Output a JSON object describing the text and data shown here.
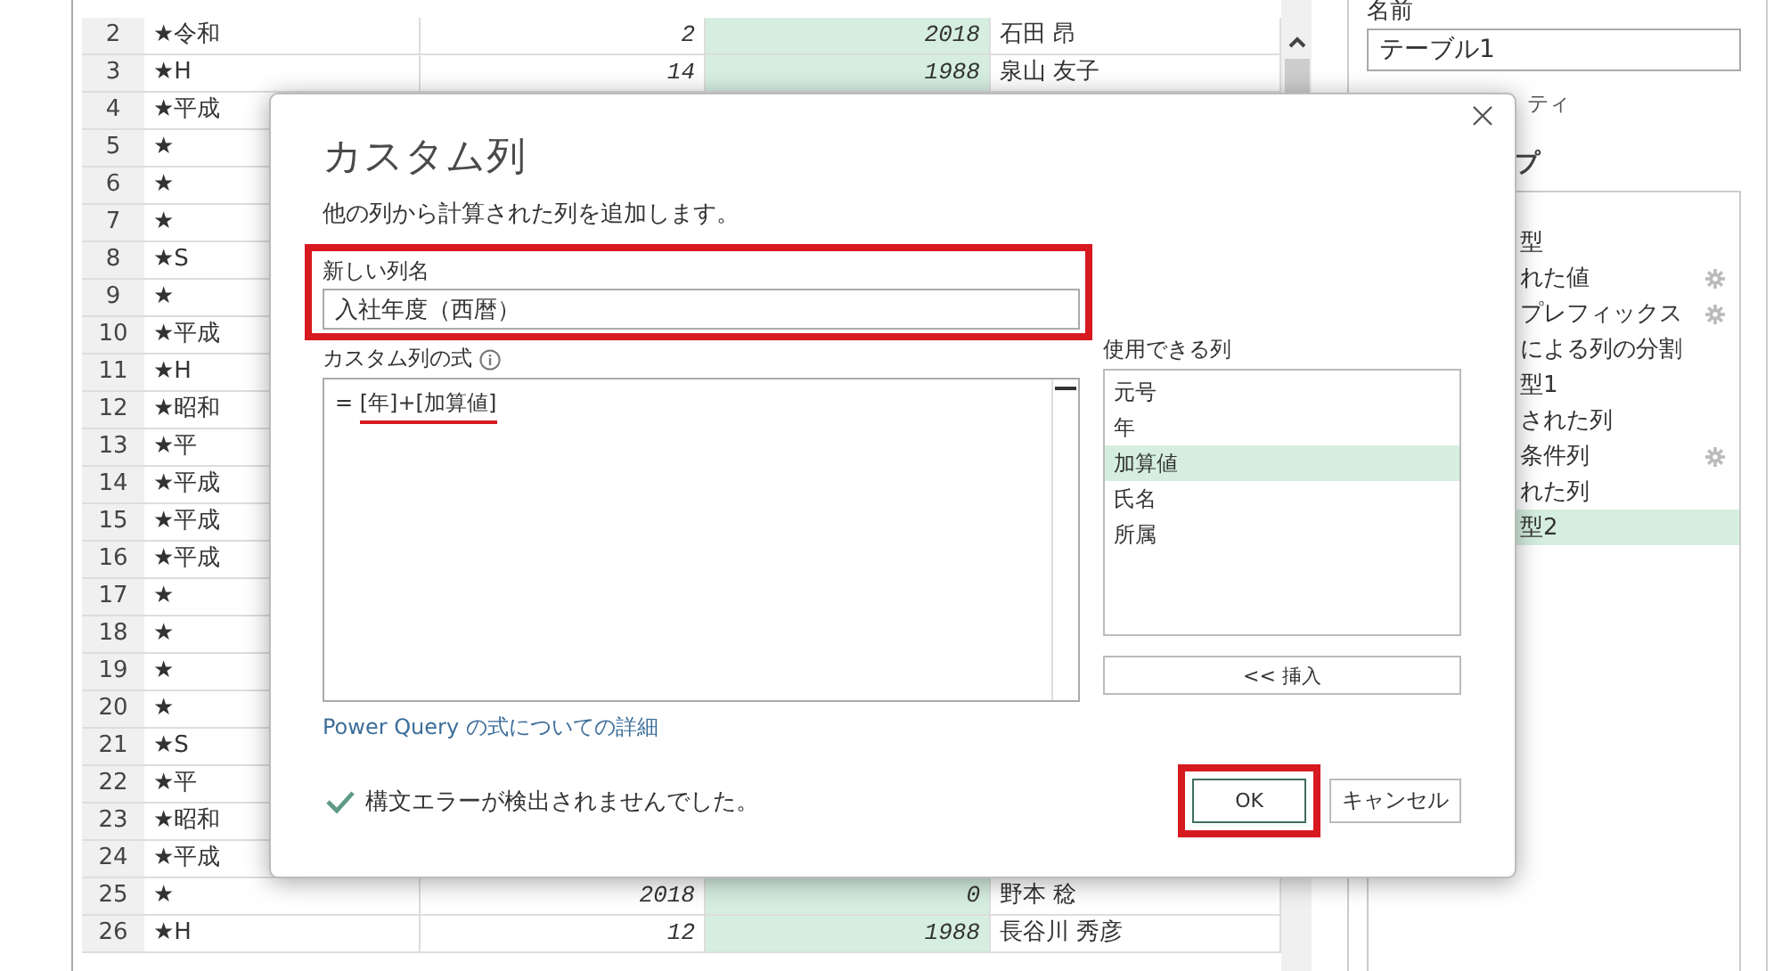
{
  "table": {
    "columns": [
      {
        "selected": false
      },
      {
        "selected": false
      },
      {
        "selected": true
      },
      {
        "selected": false
      }
    ],
    "rows": [
      {
        "number": "2",
        "cells": [
          "★令和",
          "2",
          "2018",
          "石田 昂"
        ]
      },
      {
        "number": "3",
        "cells": [
          "★H",
          "14",
          "1988",
          "泉山 友子"
        ]
      },
      {
        "number": "4",
        "cells": [
          "★平成"
        ]
      },
      {
        "number": "5",
        "cells": [
          "★"
        ]
      },
      {
        "number": "6",
        "cells": [
          "★"
        ]
      },
      {
        "number": "7",
        "cells": [
          "★"
        ]
      },
      {
        "number": "8",
        "cells": [
          "★S"
        ]
      },
      {
        "number": "9",
        "cells": [
          "★"
        ]
      },
      {
        "number": "10",
        "cells": [
          "★平成"
        ]
      },
      {
        "number": "11",
        "cells": [
          "★H"
        ]
      },
      {
        "number": "12",
        "cells": [
          "★昭和"
        ]
      },
      {
        "number": "13",
        "cells": [
          "★平"
        ]
      },
      {
        "number": "14",
        "cells": [
          "★平成"
        ]
      },
      {
        "number": "15",
        "cells": [
          "★平成"
        ]
      },
      {
        "number": "16",
        "cells": [
          "★平成"
        ]
      },
      {
        "number": "17",
        "cells": [
          "★"
        ]
      },
      {
        "number": "18",
        "cells": [
          "★"
        ]
      },
      {
        "number": "19",
        "cells": [
          "★"
        ]
      },
      {
        "number": "20",
        "cells": [
          "★"
        ]
      },
      {
        "number": "21",
        "cells": [
          "★S"
        ]
      },
      {
        "number": "22",
        "cells": [
          "★平"
        ]
      },
      {
        "number": "23",
        "cells": [
          "★昭和"
        ]
      },
      {
        "number": "24",
        "cells": [
          "★平成"
        ]
      },
      {
        "number": "25",
        "cells": [
          "★",
          "2018",
          "0",
          "野本 稔"
        ]
      },
      {
        "number": "26",
        "cells": [
          "★H",
          "12",
          "1988",
          "長谷川 秀彦"
        ]
      }
    ]
  },
  "query_settings": {
    "name_label": "名前",
    "name_value": "テーブル1",
    "properties_link": "ティ",
    "steps_title": "プ",
    "steps": [
      {
        "label": "型",
        "gear": false,
        "selected": false
      },
      {
        "label": "れた値",
        "gear": true,
        "selected": false
      },
      {
        "label": "プレフィックス",
        "gear": true,
        "selected": false
      },
      {
        "label": "による列の分割",
        "gear": false,
        "selected": false
      },
      {
        "label": "型1",
        "gear": false,
        "selected": false
      },
      {
        "label": "された列",
        "gear": false,
        "selected": false
      },
      {
        "label": "条件列",
        "gear": true,
        "selected": false
      },
      {
        "label": "れた列",
        "gear": false,
        "selected": false
      },
      {
        "label": "型2",
        "gear": false,
        "selected": true
      }
    ]
  },
  "dialog": {
    "title": "カスタム列",
    "description": "他の列から計算された列を追加します。",
    "new_column_label": "新しい列名",
    "new_column_value": "入社年度（西暦）",
    "formula_label": "カスタム列の式",
    "formula_prefix": "= ",
    "formula": "[年]+[加算値]",
    "available_label": "使用できる列",
    "available_columns": [
      {
        "label": "元号",
        "selected": false
      },
      {
        "label": "年",
        "selected": false
      },
      {
        "label": "加算値",
        "selected": true
      },
      {
        "label": "氏名",
        "selected": false
      },
      {
        "label": "所属",
        "selected": false
      }
    ],
    "insert_button": "<< 挿入",
    "help_link": "Power Query の式についての詳細",
    "status": "構文エラーが検出されませんでした。",
    "ok_button": "OK",
    "cancel_button": "キャンセル"
  }
}
